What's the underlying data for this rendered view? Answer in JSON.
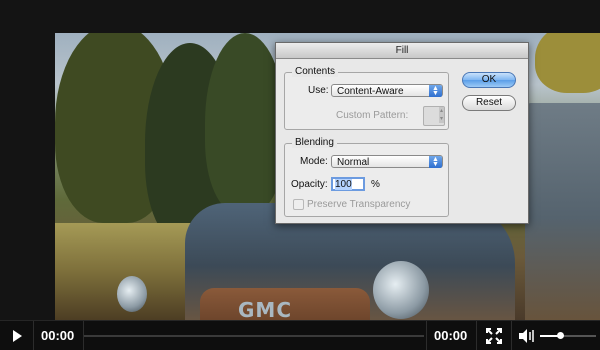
{
  "dialog": {
    "title": "Fill",
    "contents": {
      "group_label": "Contents",
      "use_label": "Use:",
      "use_value": "Content-Aware",
      "custom_pattern_label": "Custom Pattern:"
    },
    "blending": {
      "group_label": "Blending",
      "mode_label": "Mode:",
      "mode_value": "Normal",
      "opacity_label": "Opacity:",
      "opacity_value": "100",
      "opacity_unit": "%",
      "preserve_label": "Preserve Transparency"
    },
    "ok_label": "OK",
    "reset_label": "Reset"
  },
  "player": {
    "current_time": "00:00",
    "duration": "00:00",
    "progress": 0,
    "volume": 0.35,
    "icons": {
      "play": "play-icon",
      "fullscreen": "fullscreen-icon",
      "volume": "volume-icon"
    }
  },
  "colors": {
    "accent_blue": "#5a9ee8",
    "controls_bg": "#0e0e0e",
    "dialog_bg": "#e8e8e8"
  }
}
